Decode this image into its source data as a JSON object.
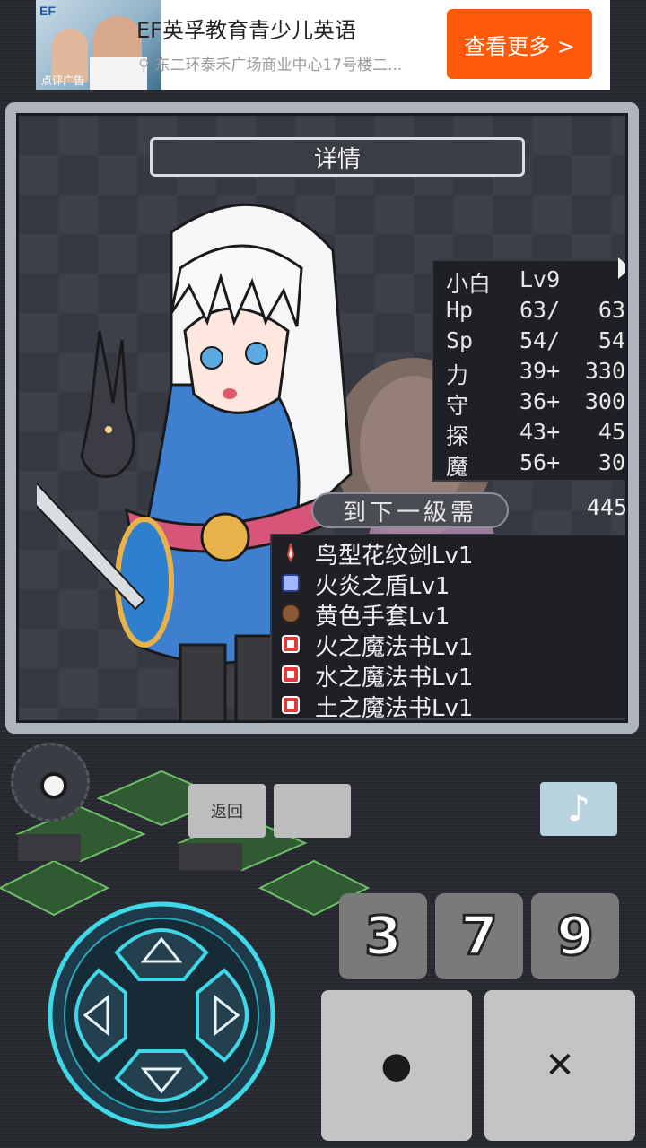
{
  "ad": {
    "title": "EF英孚教育青少儿英语",
    "address": "东二环泰禾广场商业中心17号楼二...",
    "button": "查看更多 >",
    "thumb_logo": "EF",
    "thumb_tag": "点评广告"
  },
  "panel": {
    "title": "详情",
    "stats": [
      {
        "label": "小白",
        "v1": "Lv9",
        "v2": ""
      },
      {
        "label": "Hp",
        "v1": "63/",
        "v2": "63"
      },
      {
        "label": "Sp",
        "v1": "54/",
        "v2": "54"
      },
      {
        "label": "力",
        "v1": "39+",
        "v2": "330"
      },
      {
        "label": "守",
        "v1": "36+",
        "v2": "300"
      },
      {
        "label": "探",
        "v1": "43+",
        "v2": "45"
      },
      {
        "label": "魔",
        "v1": "56+",
        "v2": "30"
      }
    ],
    "next_level_label": "到下一級需",
    "next_level_value": "445",
    "equipment": [
      {
        "name": "鸟型花纹剑Lv1",
        "icon": "sword-icon"
      },
      {
        "name": "火炎之盾Lv1",
        "icon": "shield-icon"
      },
      {
        "name": "黄色手套Lv1",
        "icon": "glove-icon"
      },
      {
        "name": "火之魔法书Lv1",
        "icon": "spellbook-icon"
      },
      {
        "name": "水之魔法书Lv1",
        "icon": "spellbook-icon"
      },
      {
        "name": "土之魔法书Lv1",
        "icon": "spellbook-icon"
      }
    ]
  },
  "controls": {
    "back_label": "返回",
    "music_symbol": "♪",
    "keys": [
      "3",
      "7",
      "9"
    ],
    "confirm_symbol": "●",
    "cancel_symbol": "✕"
  },
  "colors": {
    "ad_button": "#ff5a0a",
    "dpad_glow": "#3fd8e8",
    "panel_frame": "#aeb4bd"
  }
}
